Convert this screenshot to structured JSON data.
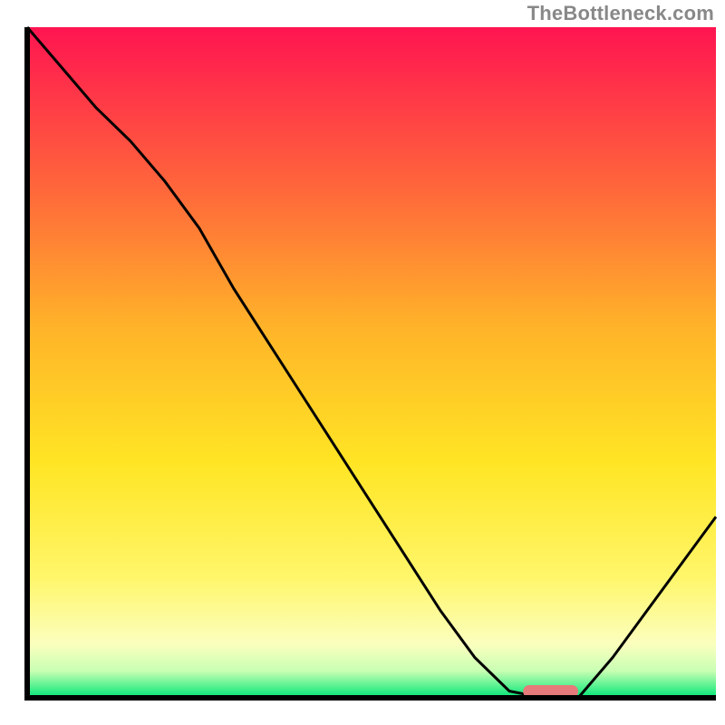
{
  "watermark": "TheBottleneck.com",
  "chart_data": {
    "type": "line",
    "title": "",
    "xlabel": "",
    "ylabel": "",
    "xlim": [
      0,
      100
    ],
    "ylim": [
      0,
      100
    ],
    "grid": false,
    "legend": false,
    "series": [
      {
        "name": "bottleneck-curve",
        "x": [
          0,
          5,
          10,
          15,
          20,
          25,
          30,
          35,
          40,
          45,
          50,
          55,
          60,
          65,
          70,
          75,
          80,
          85,
          90,
          95,
          100
        ],
        "y": [
          100,
          94,
          88,
          83,
          77,
          70,
          61,
          53,
          45,
          37,
          29,
          21,
          13,
          6,
          1,
          0,
          0,
          6,
          13,
          20,
          27
        ]
      }
    ],
    "marker": {
      "name": "optimal-range",
      "x_start": 72,
      "x_end": 80,
      "y": 0,
      "color": "#e77a7a"
    },
    "gradient_stops": [
      {
        "pos": 0.0,
        "color": "#ff1451"
      },
      {
        "pos": 0.25,
        "color": "#ff6a3a"
      },
      {
        "pos": 0.45,
        "color": "#ffb429"
      },
      {
        "pos": 0.65,
        "color": "#ffe524"
      },
      {
        "pos": 0.82,
        "color": "#fff66a"
      },
      {
        "pos": 0.92,
        "color": "#fbffbe"
      },
      {
        "pos": 0.96,
        "color": "#c8ffb3"
      },
      {
        "pos": 1.0,
        "color": "#00e676"
      }
    ]
  }
}
